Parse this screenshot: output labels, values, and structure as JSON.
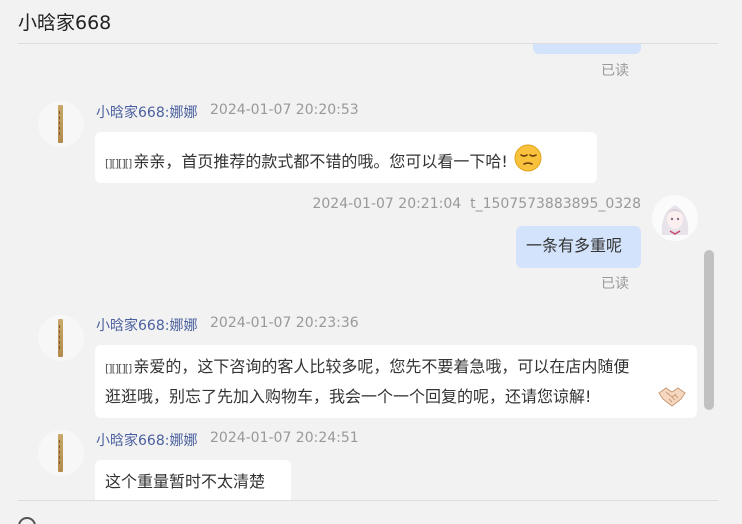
{
  "header": {
    "title": "小晗家668"
  },
  "messages": [
    {
      "read_label": "已读"
    },
    {
      "sender": "小晗家668:娜娜",
      "time": "2024-01-07 20:20:53",
      "prefix": "[][][][]",
      "text": "亲亲，首页推荐的款式都不错的哦。您可以看一下哈!",
      "emoji": "pensive-face-emoji"
    },
    {
      "time": "2024-01-07 20:21:04",
      "user": "t_1507573883895_0328",
      "text": "一条有多重呢",
      "read_label": "已读"
    },
    {
      "sender": "小晗家668:娜娜",
      "time": "2024-01-07 20:23:36",
      "prefix": "[][][][]",
      "text_line1": "亲爱的，这下咨询的客人比较多呢，您先不要着急哦，可以在店内随便",
      "text_line2": "逛逛哦，别忘了先加入购物车，我会一个一个回复的呢，还请您谅解!",
      "emoji": "handshake-emoji"
    },
    {
      "sender": "小晗家668:娜娜",
      "time": "2024-01-07 20:24:51",
      "text": "这个重量暂时不太清楚"
    }
  ],
  "colors": {
    "background": "#f2f2f2",
    "incoming_bubble": "#ffffff",
    "outgoing_bubble": "#d3e3fb",
    "sender_name": "#4a5f9e",
    "meta": "#999999"
  }
}
